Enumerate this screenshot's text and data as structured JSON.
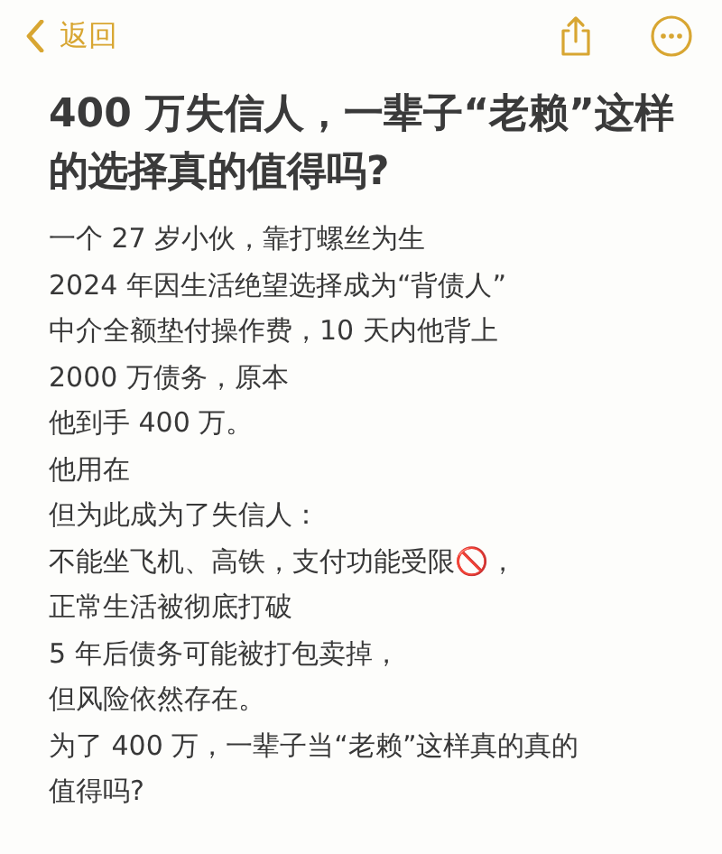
{
  "nav": {
    "back_label": "返回"
  },
  "note": {
    "title": "400 万失信人，一辈子“老赖”这样的选择真的值得吗?",
    "lines": [
      "一个 27 岁小伙，靠打螺丝为生",
      "2024 年因生活绝望选择成为“背债人”",
      "中介全额垫付操作费，10 天内他背上",
      "2000 万债务，原本",
      "他到手 400 万。",
      "他用在",
      "但为此成为了失信人：",
      "不能坐飞机、高铁，支付功能受限🚫，",
      "正常生活被彻底打破",
      "5 年后债务可能被打包卖掉，",
      "但风险依然存在。",
      "为了 400 万，一辈子当“老赖”这样真的真的",
      "值得吗?"
    ]
  }
}
